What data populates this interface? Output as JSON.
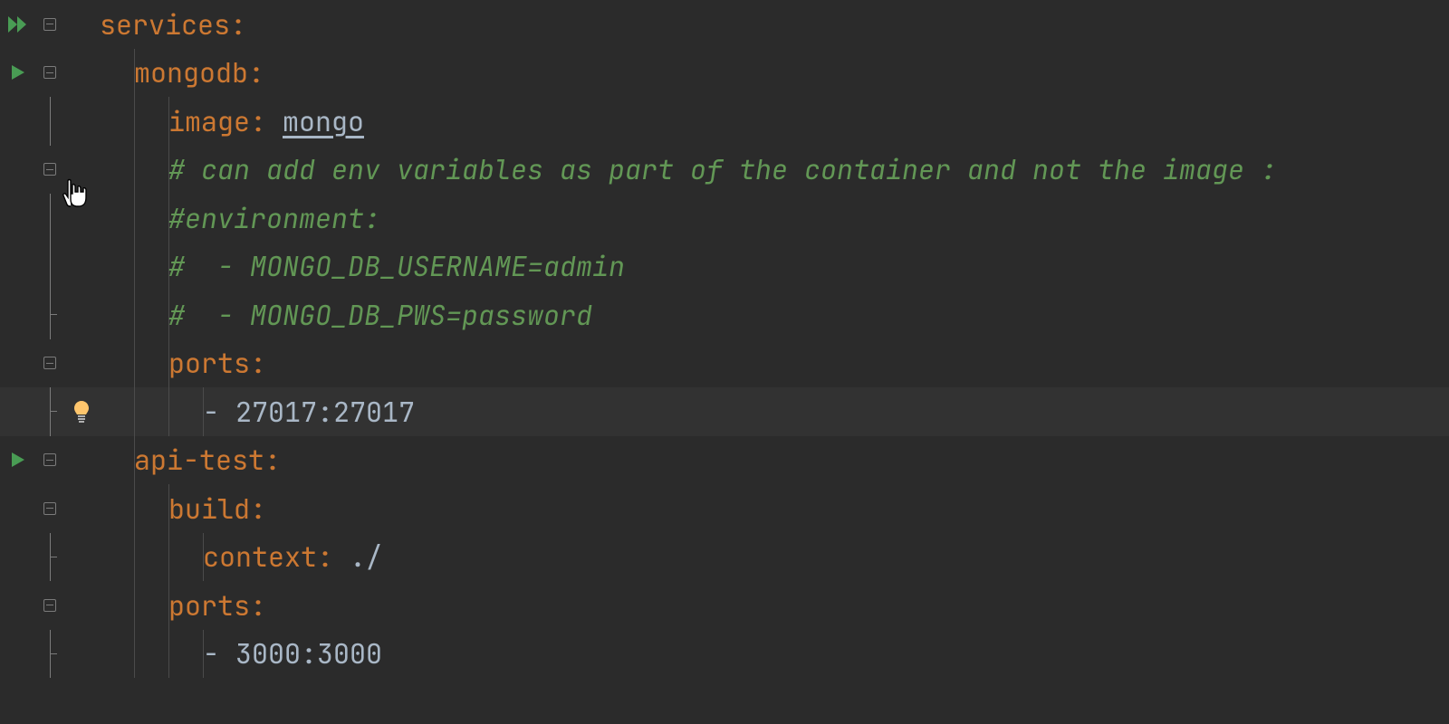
{
  "colors": {
    "bg": "#2b2b2b",
    "key": "#cc7832",
    "comment": "#629755",
    "value": "#a9b7c6",
    "run": "#499c54",
    "bulb": "#ffc66d",
    "guide": "#4b4b4b",
    "currentLine": "#323232"
  },
  "bulb": "bulb-icon",
  "cursor": "pointer-cursor",
  "currentLineIndex": 8,
  "lines": [
    {
      "indent": 0,
      "segments": [
        {
          "t": "key",
          "v": "services"
        },
        {
          "t": "colon",
          "v": ":"
        }
      ],
      "run": "all",
      "fold": "open"
    },
    {
      "indent": 1,
      "segments": [
        {
          "t": "key",
          "v": "mongodb"
        },
        {
          "t": "colon",
          "v": ":"
        }
      ],
      "run": "single",
      "fold": "open"
    },
    {
      "indent": 2,
      "segments": [
        {
          "t": "key",
          "v": "image"
        },
        {
          "t": "colon",
          "v": ": "
        },
        {
          "t": "val-underline",
          "v": "mongo"
        }
      ],
      "fold": "line"
    },
    {
      "indent": 2,
      "segments": [
        {
          "t": "comment",
          "v": "# can add env variables as part of the container and not the image :"
        }
      ],
      "fold": "open"
    },
    {
      "indent": 2,
      "segments": [
        {
          "t": "comment",
          "v": "#environment:"
        }
      ],
      "fold": "line"
    },
    {
      "indent": 2,
      "segments": [
        {
          "t": "comment",
          "v": "#  - MONGO_DB_USERNAME=admin"
        }
      ],
      "fold": "line"
    },
    {
      "indent": 2,
      "segments": [
        {
          "t": "comment",
          "v": "#  - MONGO_DB_PWS=password"
        }
      ],
      "fold": "end"
    },
    {
      "indent": 2,
      "segments": [
        {
          "t": "key",
          "v": "ports"
        },
        {
          "t": "colon",
          "v": ":"
        }
      ],
      "fold": "open"
    },
    {
      "indent": 3,
      "segments": [
        {
          "t": "dash",
          "v": "- "
        },
        {
          "t": "val",
          "v": "27017:27017"
        }
      ],
      "fold": "end",
      "bulb": true
    },
    {
      "indent": 1,
      "segments": [
        {
          "t": "key",
          "v": "api-test"
        },
        {
          "t": "colon",
          "v": ":"
        }
      ],
      "run": "single",
      "fold": "open"
    },
    {
      "indent": 2,
      "segments": [
        {
          "t": "key",
          "v": "build"
        },
        {
          "t": "colon",
          "v": ":"
        }
      ],
      "fold": "open"
    },
    {
      "indent": 3,
      "segments": [
        {
          "t": "key",
          "v": "context"
        },
        {
          "t": "colon",
          "v": ": "
        },
        {
          "t": "val",
          "v": "./"
        }
      ],
      "fold": "end"
    },
    {
      "indent": 2,
      "segments": [
        {
          "t": "key",
          "v": "ports"
        },
        {
          "t": "colon",
          "v": ":"
        }
      ],
      "fold": "open"
    },
    {
      "indent": 3,
      "segments": [
        {
          "t": "dash",
          "v": "- "
        },
        {
          "t": "val",
          "v": "3000:3000"
        }
      ],
      "fold": "end"
    }
  ]
}
